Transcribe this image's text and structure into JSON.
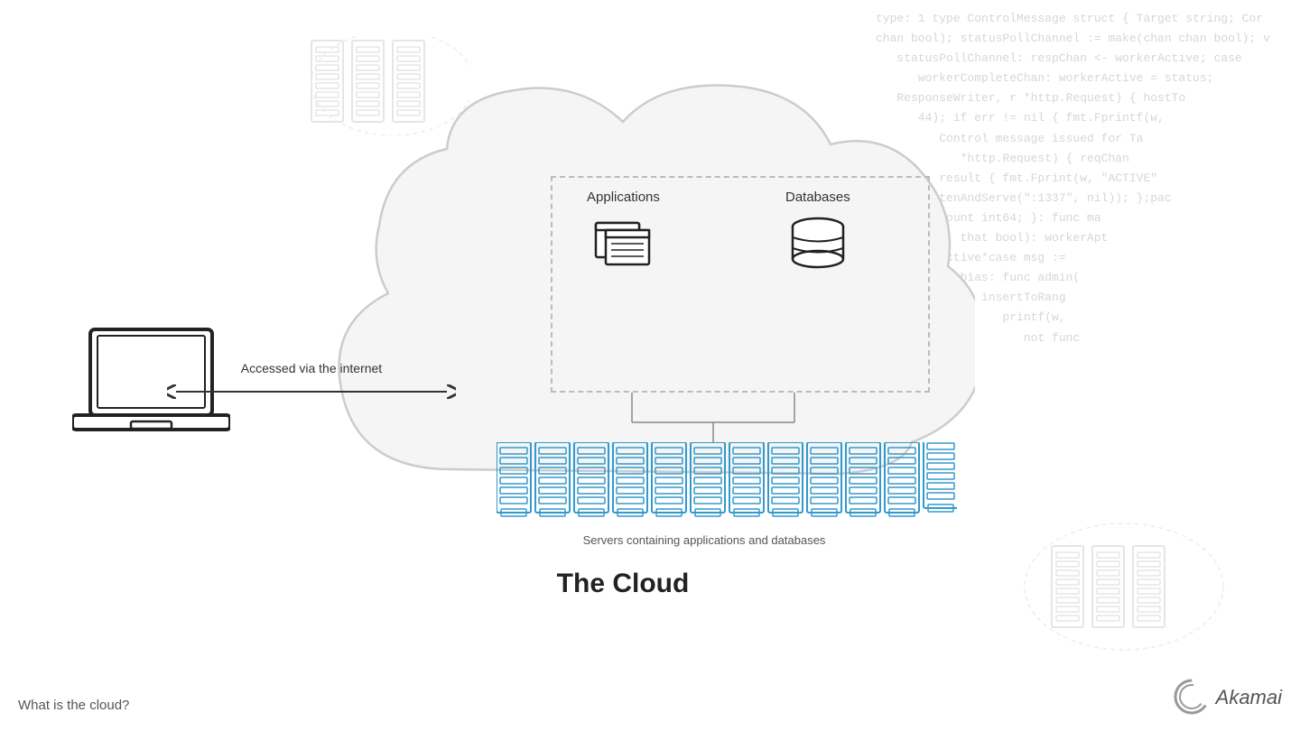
{
  "page": {
    "background_color": "#ffffff",
    "title": "What is the cloud?"
  },
  "code_bg": {
    "lines": [
      "type: 1 type ControlMessage struct { Target string; Cor",
      "chan bool); statusPollChannel := make(chan chan bool); v",
      "   statusPollChannel: respChan <- workerActive; case",
      "      workerCompleteChan: workerActive = status;",
      "   ResponseWriter, r *http.Request) { hostTo",
      "      44); if err != nil { fmt.Fprintf(w,",
      "         Control message issued for Ta",
      "            *http.Request) { reqChan",
      "         result { fmt.Fprint(w, \"ACTIVE\"",
      "      ListenAndServe(\":1337\", nil)); };pac",
      "         Count int64; }: func ma",
      "            that bool): workerApt",
      "         active*case msg :=",
      "            bias: func admin(",
      "               insertToRang",
      "                  printf(w,",
      "                     not func"
    ]
  },
  "diagram": {
    "arrow_text": "Accessed via the internet",
    "applications_label": "Applications",
    "databases_label": "Databases",
    "servers_label": "Servers containing applications and databases",
    "cloud_title": "The Cloud"
  },
  "footer": {
    "bottom_label": "What is the cloud?",
    "akamai_label": "Akamai"
  }
}
